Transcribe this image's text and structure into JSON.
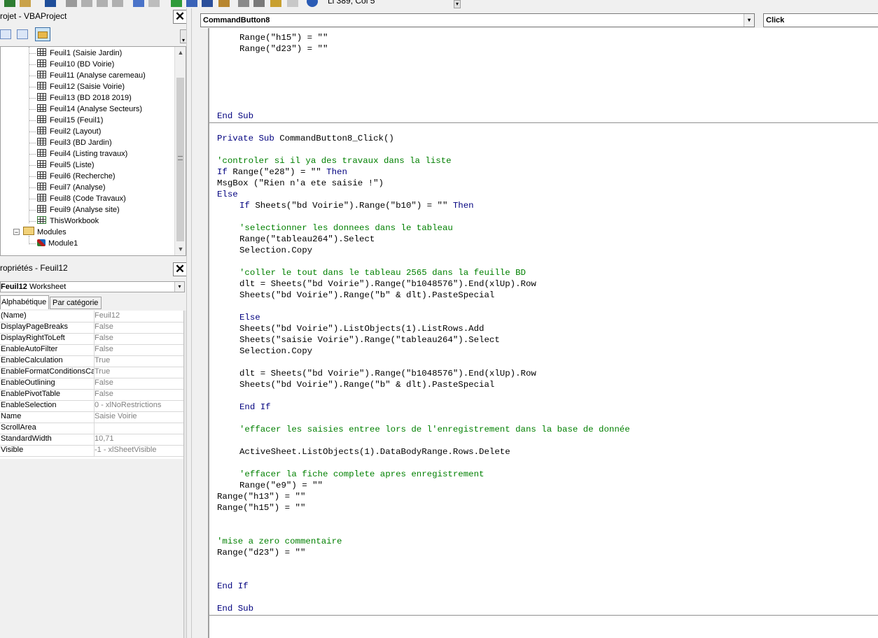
{
  "toolbar": {
    "cursor_position": "Li 389, Col 5"
  },
  "project_panel": {
    "title": "rojet - VBAProject",
    "tree": [
      {
        "label": "Feuil1 (Saisie Jardin)",
        "type": "sheet"
      },
      {
        "label": "Feuil10 (BD Voirie)",
        "type": "sheet"
      },
      {
        "label": "Feuil11 (Analyse caremeau)",
        "type": "sheet"
      },
      {
        "label": "Feuil12 (Saisie Voirie)",
        "type": "sheet"
      },
      {
        "label": "Feuil13 (BD 2018 2019)",
        "type": "sheet"
      },
      {
        "label": "Feuil14 (Analyse Secteurs)",
        "type": "sheet"
      },
      {
        "label": "Feuil15 (Feuil1)",
        "type": "sheet"
      },
      {
        "label": "Feuil2 (Layout)",
        "type": "sheet"
      },
      {
        "label": "Feuil3 (BD Jardin)",
        "type": "sheet"
      },
      {
        "label": "Feuil4 (Listing travaux)",
        "type": "sheet"
      },
      {
        "label": "Feuil5 (Liste)",
        "type": "sheet"
      },
      {
        "label": "Feuil6 (Recherche)",
        "type": "sheet"
      },
      {
        "label": "Feuil7 (Analyse)",
        "type": "sheet"
      },
      {
        "label": "Feuil8 (Code Travaux)",
        "type": "sheet"
      },
      {
        "label": "Feuil9 (Analyse site)",
        "type": "sheet"
      },
      {
        "label": "ThisWorkbook",
        "type": "workbook"
      },
      {
        "label": "Modules",
        "type": "folder"
      },
      {
        "label": "Module1",
        "type": "module"
      }
    ]
  },
  "properties_panel": {
    "title": "ropriétés - Feuil12",
    "object_name": "Feuil12",
    "object_type": "Worksheet",
    "tabs": [
      "Alphabétique",
      "Par catégorie"
    ],
    "rows": [
      {
        "name": "(Name)",
        "value": "Feuil12"
      },
      {
        "name": "DisplayPageBreaks",
        "value": "False"
      },
      {
        "name": "DisplayRightToLeft",
        "value": "False"
      },
      {
        "name": "EnableAutoFilter",
        "value": "False"
      },
      {
        "name": "EnableCalculation",
        "value": "True"
      },
      {
        "name": "EnableFormatConditionsCalc",
        "value": "True"
      },
      {
        "name": "EnableOutlining",
        "value": "False"
      },
      {
        "name": "EnablePivotTable",
        "value": "False"
      },
      {
        "name": "EnableSelection",
        "value": "0 - xlNoRestrictions"
      },
      {
        "name": "Name",
        "value": "Saisie Voirie"
      },
      {
        "name": "ScrollArea",
        "value": ""
      },
      {
        "name": "StandardWidth",
        "value": "10,71"
      },
      {
        "name": "Visible",
        "value": "-1 - xlSheetVisible"
      }
    ]
  },
  "code_window": {
    "object_combo": "CommandButton8",
    "procedure_combo": "Click",
    "lines": [
      {
        "indent": 4,
        "parts": [
          {
            "t": "Range(\"h15\") = \"\"",
            "c": "tx"
          }
        ]
      },
      {
        "indent": 4,
        "parts": [
          {
            "t": "Range(\"d23\") = \"\"",
            "c": "tx"
          }
        ]
      },
      {
        "blank": true
      },
      {
        "blank": true
      },
      {
        "blank": true
      },
      {
        "blank": true
      },
      {
        "blank": true
      },
      {
        "indent": 0,
        "parts": [
          {
            "t": "End Sub",
            "c": "kw"
          }
        ]
      },
      {
        "blank": true,
        "separator": true
      },
      {
        "indent": 0,
        "parts": [
          {
            "t": "Private Sub ",
            "c": "kw"
          },
          {
            "t": "CommandButton8_Click()",
            "c": "tx"
          }
        ]
      },
      {
        "blank": true
      },
      {
        "indent": 0,
        "parts": [
          {
            "t": "'controler si il ya des travaux dans la liste",
            "c": "cm"
          }
        ]
      },
      {
        "indent": 0,
        "parts": [
          {
            "t": "If ",
            "c": "kw"
          },
          {
            "t": "Range(\"e28\") = \"\" ",
            "c": "tx"
          },
          {
            "t": "Then",
            "c": "kw"
          }
        ]
      },
      {
        "indent": 0,
        "parts": [
          {
            "t": "MsgBox (\"Rien n'a ete saisie !\")",
            "c": "tx"
          }
        ]
      },
      {
        "indent": 0,
        "parts": [
          {
            "t": "Else",
            "c": "kw"
          }
        ]
      },
      {
        "indent": 4,
        "parts": [
          {
            "t": "If ",
            "c": "kw"
          },
          {
            "t": "Sheets(\"bd Voirie\").Range(\"b10\") = \"\" ",
            "c": "tx"
          },
          {
            "t": "Then",
            "c": "kw"
          }
        ]
      },
      {
        "blank": true
      },
      {
        "indent": 4,
        "parts": [
          {
            "t": "'selectionner les donnees dans le tableau",
            "c": "cm"
          }
        ]
      },
      {
        "indent": 4,
        "parts": [
          {
            "t": "Range(\"tableau264\").Select",
            "c": "tx"
          }
        ]
      },
      {
        "indent": 4,
        "parts": [
          {
            "t": "Selection.Copy",
            "c": "tx"
          }
        ]
      },
      {
        "blank": true
      },
      {
        "indent": 4,
        "parts": [
          {
            "t": "'coller le tout dans le tableau 2565 dans la feuille BD",
            "c": "cm"
          }
        ]
      },
      {
        "indent": 4,
        "parts": [
          {
            "t": "dlt = Sheets(\"bd Voirie\").Range(\"b1048576\").End(xlUp).Row",
            "c": "tx"
          }
        ]
      },
      {
        "indent": 4,
        "parts": [
          {
            "t": "Sheets(\"bd Voirie\").Range(\"b\" & dlt).PasteSpecial",
            "c": "tx"
          }
        ]
      },
      {
        "blank": true
      },
      {
        "indent": 4,
        "parts": [
          {
            "t": "Else",
            "c": "kw"
          }
        ]
      },
      {
        "indent": 4,
        "parts": [
          {
            "t": "Sheets(\"bd Voirie\").ListObjects(1).ListRows.Add",
            "c": "tx"
          }
        ]
      },
      {
        "indent": 4,
        "parts": [
          {
            "t": "Sheets(\"saisie Voirie\").Range(\"tableau264\").Select",
            "c": "tx"
          }
        ]
      },
      {
        "indent": 4,
        "parts": [
          {
            "t": "Selection.Copy",
            "c": "tx"
          }
        ]
      },
      {
        "blank": true
      },
      {
        "indent": 4,
        "parts": [
          {
            "t": "dlt = Sheets(\"bd Voirie\").Range(\"b1048576\").End(xlUp).Row",
            "c": "tx"
          }
        ]
      },
      {
        "indent": 4,
        "parts": [
          {
            "t": "Sheets(\"bd Voirie\").Range(\"b\" & dlt).PasteSpecial",
            "c": "tx"
          }
        ]
      },
      {
        "blank": true
      },
      {
        "indent": 4,
        "parts": [
          {
            "t": "End If",
            "c": "kw"
          }
        ]
      },
      {
        "blank": true
      },
      {
        "indent": 4,
        "parts": [
          {
            "t": "'effacer les saisies entree lors de l'enregistrement dans la base de donnée",
            "c": "cm"
          }
        ]
      },
      {
        "blank": true
      },
      {
        "indent": 4,
        "parts": [
          {
            "t": "ActiveSheet.ListObjects(1).DataBodyRange.Rows.Delete",
            "c": "tx"
          }
        ]
      },
      {
        "blank": true
      },
      {
        "indent": 4,
        "parts": [
          {
            "t": "'effacer la fiche complete apres enregistrement",
            "c": "cm"
          }
        ]
      },
      {
        "indent": 4,
        "parts": [
          {
            "t": "Range(\"e9\") = \"\"",
            "c": "tx"
          }
        ]
      },
      {
        "indent": 0,
        "parts": [
          {
            "t": "Range(\"h13\") = \"\"",
            "c": "tx"
          }
        ]
      },
      {
        "indent": 0,
        "parts": [
          {
            "t": "Range(\"h15\") = \"\"",
            "c": "tx"
          }
        ]
      },
      {
        "blank": true
      },
      {
        "blank": true
      },
      {
        "indent": 0,
        "parts": [
          {
            "t": "'mise a zero commentaire",
            "c": "cm"
          }
        ]
      },
      {
        "indent": 0,
        "parts": [
          {
            "t": "Range(\"d23\") = \"\"",
            "c": "tx"
          }
        ]
      },
      {
        "blank": true
      },
      {
        "blank": true
      },
      {
        "indent": 0,
        "parts": [
          {
            "t": "End If",
            "c": "kw"
          }
        ]
      },
      {
        "blank": true
      },
      {
        "indent": 0,
        "parts": [
          {
            "t": "End Sub",
            "c": "kw"
          }
        ]
      },
      {
        "blank": true,
        "separator": true
      }
    ]
  },
  "colors": {
    "keyword": "#00007f",
    "comment": "#008000",
    "text": "#000000"
  }
}
